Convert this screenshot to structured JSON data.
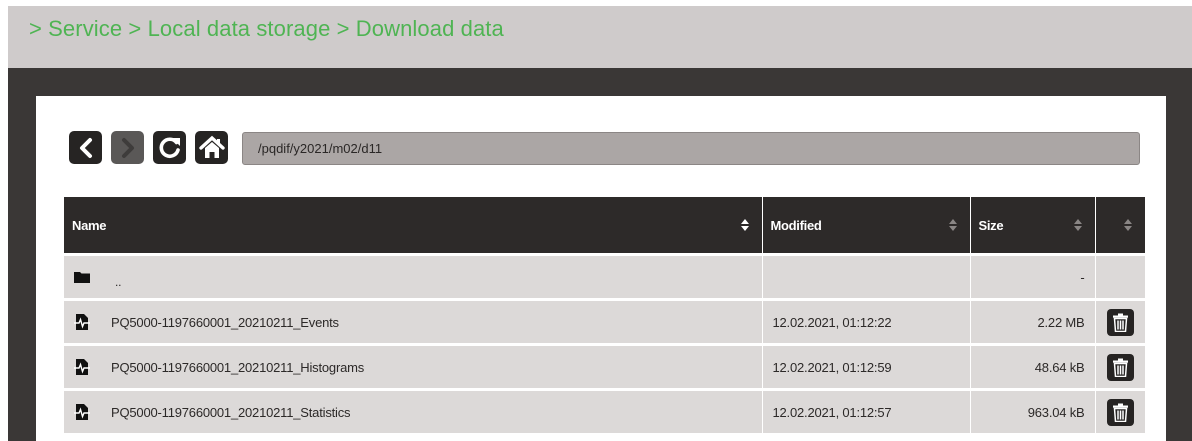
{
  "breadcrumb": "> Service > Local data storage > Download data",
  "toolbar": {
    "back_icon": "chevron-left-icon",
    "forward_icon": "chevron-right-icon",
    "refresh_icon": "refresh-icon",
    "home_icon": "home-icon",
    "path_value": "/pqdif/y2021/m02/d11"
  },
  "table": {
    "columns": [
      {
        "label": "Name"
      },
      {
        "label": "Modified"
      },
      {
        "label": "Size"
      },
      {
        "label": ""
      }
    ],
    "parent_row": {
      "icon": "folder-icon",
      "name": "..",
      "modified": "",
      "size": "-"
    },
    "rows": [
      {
        "icon": "file-icon",
        "name": "PQ5000-1197660001_20210211_Events",
        "modified": "12.02.2021, 01:12:22",
        "size": "2.22 MB",
        "action_icon": "trash-icon"
      },
      {
        "icon": "file-icon",
        "name": "PQ5000-1197660001_20210211_Histograms",
        "modified": "12.02.2021, 01:12:59",
        "size": "48.64 kB",
        "action_icon": "trash-icon"
      },
      {
        "icon": "file-icon",
        "name": "PQ5000-1197660001_20210211_Statistics",
        "modified": "12.02.2021, 01:12:57",
        "size": "963.04 kB",
        "action_icon": "trash-icon"
      }
    ]
  },
  "colors": {
    "breadcrumb_text": "#4fb453",
    "header_background": "#cfcbcb",
    "frame_background": "#3a3736",
    "table_header": "#2d2a29",
    "row_background": "#dcd9d8",
    "path_field": "#aba6a5"
  }
}
